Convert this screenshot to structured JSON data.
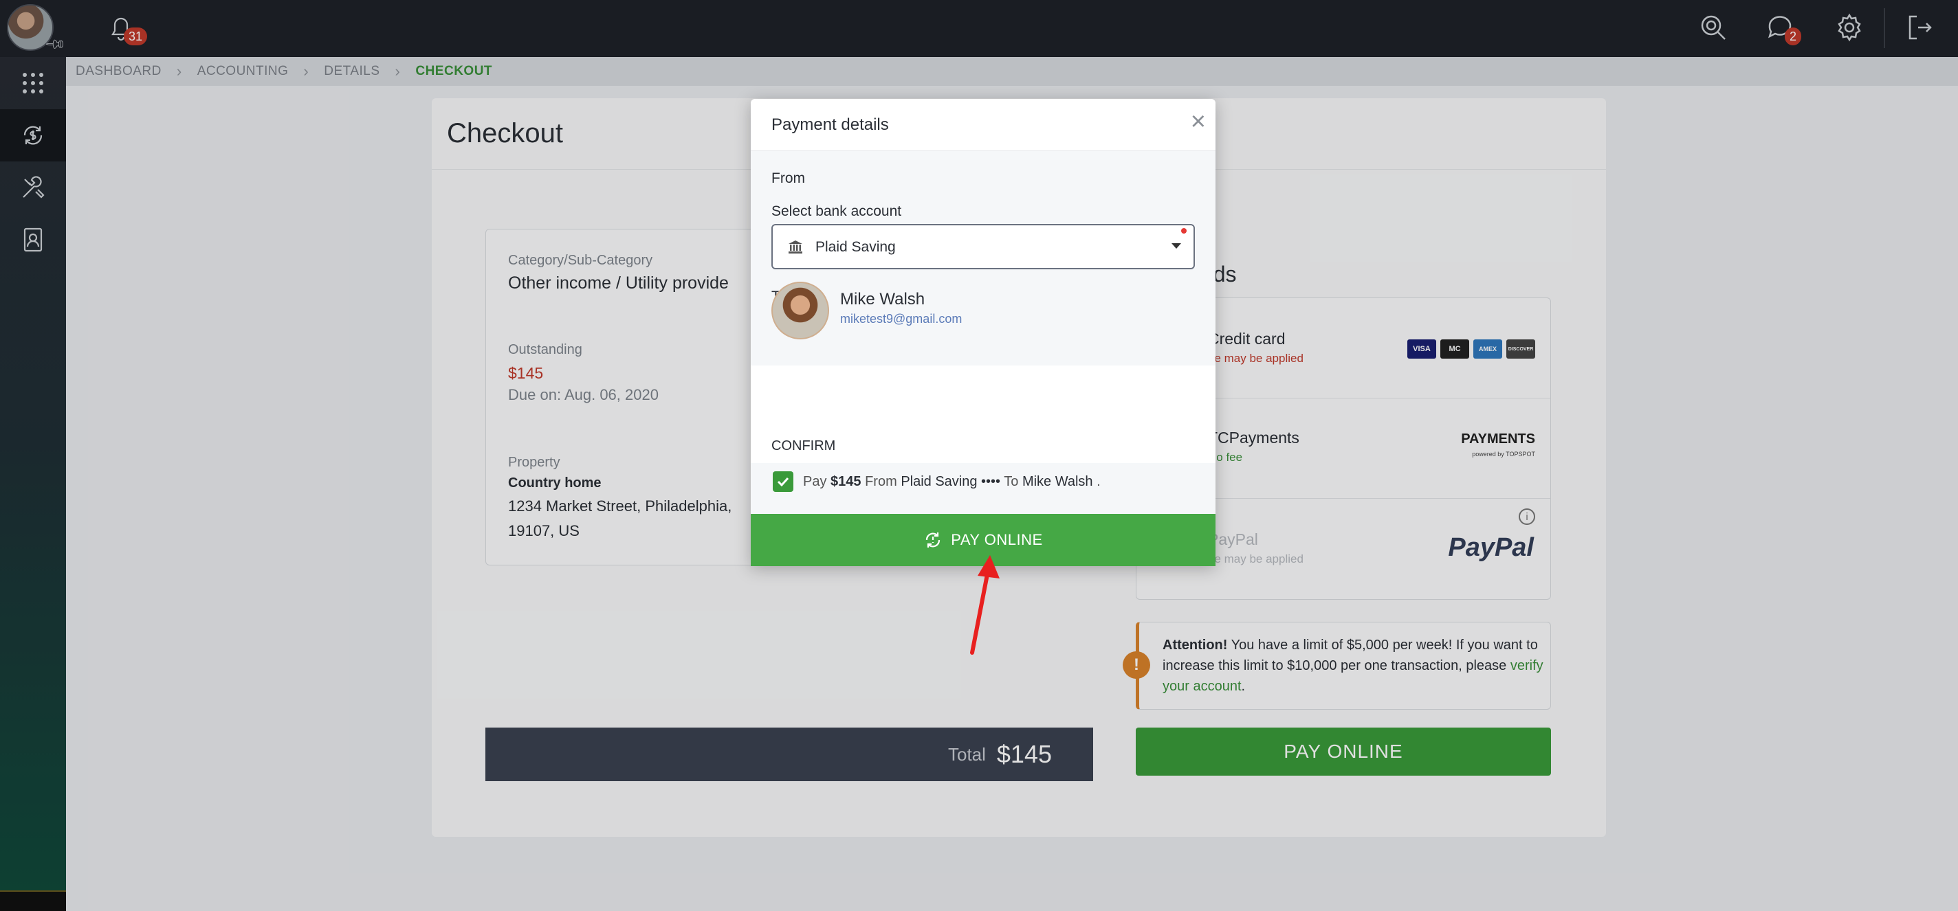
{
  "topbar": {
    "notifications_count": "31",
    "messages_count": "2",
    "icons": [
      "search-icon",
      "chat-icon",
      "gear-icon",
      "logout-icon"
    ]
  },
  "sidebar": {
    "items": [
      {
        "icon": "apps-grid-icon"
      },
      {
        "icon": "accounting-icon"
      },
      {
        "icon": "tools-icon"
      },
      {
        "icon": "contacts-icon"
      }
    ]
  },
  "breadcrumb": [
    "DASHBOARD",
    "ACCOUNTING",
    "DETAILS",
    "CHECKOUT"
  ],
  "checkout": {
    "title": "Checkout",
    "category_label": "Category/Sub-Category",
    "category_value": "Other income /  Utility provide",
    "outstanding_label": "Outstanding",
    "outstanding_value": "$145",
    "due_on": "Due on: Aug. 06, 2020",
    "property_label": "Property",
    "property_name": "Country home",
    "property_address_1": "1234 Market Street, Philadelphia,",
    "property_address_2": "19107, US",
    "total_label": "Total",
    "total_value": "$145",
    "pay_button": "PAY ONLINE"
  },
  "payment_methods": {
    "title": "t methods",
    "items": [
      {
        "name": "Credit card",
        "note": "ee may be applied",
        "note_color": "#c0392b"
      },
      {
        "name": "TCPayments",
        "note": "No fee",
        "note_color": "#3a8f3a"
      },
      {
        "name": "PayPal",
        "note": "ee may be applied",
        "note_color": "#b5b9bf"
      }
    ],
    "card_logos": [
      "VISA",
      "MC",
      "AMEX",
      "DISCOVER"
    ],
    "paym_logo": "PAYMENTS",
    "paym_sub": "powered by TOPSPOT",
    "paypal_logo": "PayPal"
  },
  "attention": {
    "title": "Attention!",
    "text": " You have a limit of $5,000 per week! If you want to increase this limit to $10,000 per one transaction, please ",
    "link": "verify your account",
    "end": "."
  },
  "modal": {
    "title": "Payment details",
    "from_label": "From",
    "select_label": "Select bank account",
    "select_value": "Plaid Saving",
    "to_label": "To",
    "recipient_name": "Mike Walsh",
    "recipient_email": "miketest9@gmail.com",
    "confirm_label": "CONFIRM",
    "confirm_pre": "Pay ",
    "confirm_amount": "$145",
    "confirm_from": " From ",
    "confirm_account": "Plaid Saving ••••",
    "confirm_to": " To ",
    "confirm_recipient": "Mike Walsh",
    "confirm_end": " .",
    "pay_button": "PAY ONLINE"
  },
  "colors": {
    "accent_green": "#45a845",
    "topbar_bg": "#1e2128",
    "warning_orange": "#d9822b",
    "badge_red": "#c0392b"
  }
}
